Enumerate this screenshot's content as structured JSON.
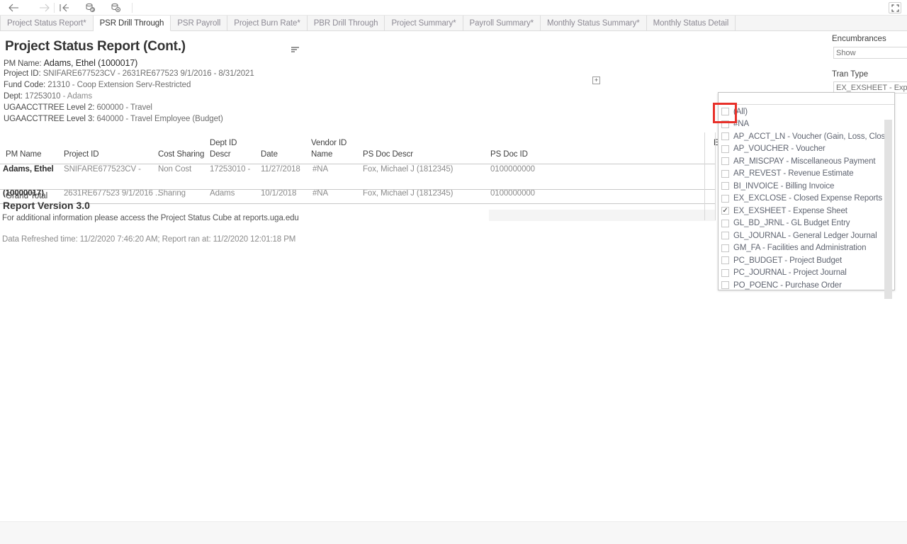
{
  "toolbar": {
    "icons": [
      {
        "name": "back-arrow-icon",
        "glyph": "←"
      },
      {
        "name": "forward-arrow-icon",
        "glyph": "→"
      },
      {
        "name": "revert-all-icon",
        "glyph": "⇤"
      },
      {
        "name": "refresh-data-source-icon",
        "glyph": "refresh"
      },
      {
        "name": "pause-auto-updates-icon",
        "glyph": "pause"
      }
    ],
    "fullscreen_label": "⛶"
  },
  "tabs": [
    {
      "label": "Project Status Report*",
      "active": false
    },
    {
      "label": "PSR Drill Through",
      "active": true
    },
    {
      "label": "PSR Payroll",
      "active": false
    },
    {
      "label": "Project Burn Rate*",
      "active": false
    },
    {
      "label": "PBR Drill Through",
      "active": false
    },
    {
      "label": "Project Summary*",
      "active": false
    },
    {
      "label": "Payroll Summary*",
      "active": false
    },
    {
      "label": "Monthly Status Summary*",
      "active": false
    },
    {
      "label": "Monthly Status Detail",
      "active": false
    }
  ],
  "report": {
    "title": "Project Status Report (Cont.)",
    "meta": {
      "pm_name_label": "PM Name:",
      "pm_name_value": "Adams, Ethel (1000017)",
      "project_id_label": "Project ID:",
      "project_id_value": "SNIFARE677523CV - 2631RE677523 9/1/2016 - 8/31/2021",
      "fund_code_label": "Fund Code:",
      "fund_code_value": "21310 - Coop Extension Serv-Restricted",
      "dept_label": "Dept:",
      "dept_value": "17253010",
      "dept_suffix": " - Adams",
      "level2_label": "UGAACCTTREE Level 2:",
      "level2_value": " 600000 - Travel",
      "level3_label": "UGAACCTTREE Level 3:",
      "level3_value": " 640000 - Travel Employee (Budget)"
    },
    "version": "Report Version 3.0",
    "note": "For additional information please access the Project Status Cube at reports.uga.edu",
    "refresh": "Data Refreshed time: 11/2/2020 7:46:20 AM; Report ran at: 11/2/2020 12:01:18 PM"
  },
  "table": {
    "headers": {
      "pm_name": "PM Name",
      "project_id": "Project ID",
      "cost_sharing": "Cost Sharing",
      "dept_id_descr_l1": "Dept ID",
      "dept_id_descr_l2": "Descr",
      "date": "Date",
      "vendor_id_l1": "Vendor ID",
      "vendor_id_l2": "Name",
      "ps_doc_descr": "PS Doc Descr",
      "ps_doc_id": "PS Doc ID",
      "hidden_col": "E"
    },
    "group_cells": {
      "pm_name_l1": "Adams, Ethel",
      "pm_name_l2": "(10000017)",
      "project_id_l1": "SNIFARE677523CV -",
      "project_id_l2": "2631RE677523 9/1/2016 ..",
      "cost_sharing_l1": "Non Cost",
      "cost_sharing_l2": "Sharing",
      "dept_descr_l1": "17253010 -",
      "dept_descr_l2": "Adams"
    },
    "rows": [
      {
        "date": "11/27/2018",
        "vendor_id_name": "#NA",
        "ps_doc_descr": "Fox, Michael J (1812345)",
        "ps_doc_id": "0100000000"
      },
      {
        "date": "10/1/2018",
        "vendor_id_name": "#NA",
        "ps_doc_descr": "Fox, Michael J (1812345)",
        "ps_doc_id": "0100000000"
      }
    ],
    "grand_total": "Grand Total",
    "expand_glyph": "+"
  },
  "filters": {
    "encumbrances_label": "Encumbrances",
    "encumbrances_value": "Show",
    "tran_type_label": "Tran Type",
    "tran_type_value": "EX_EXSHEET - Exp"
  },
  "dropdown": {
    "search_value": "",
    "items": [
      {
        "label": "(All)",
        "checked": false
      },
      {
        "label": "#NA",
        "checked": false
      },
      {
        "label": "AP_ACCT_LN - Voucher (Gain, Loss, Close)",
        "checked": false
      },
      {
        "label": "AP_VOUCHER - Voucher",
        "checked": false
      },
      {
        "label": "AR_MISCPAY - Miscellaneous Payment",
        "checked": false
      },
      {
        "label": "AR_REVEST - Revenue Estimate",
        "checked": false
      },
      {
        "label": "BI_INVOICE - Billing Invoice",
        "checked": false
      },
      {
        "label": "EX_EXCLOSE - Closed Expense Reports",
        "checked": false
      },
      {
        "label": "EX_EXSHEET - Expense Sheet",
        "checked": true
      },
      {
        "label": "GL_BD_JRNL - GL Budget Entry",
        "checked": false
      },
      {
        "label": "GL_JOURNAL - General Ledger Journal",
        "checked": false
      },
      {
        "label": "GM_FA - Facilities and Administration",
        "checked": false
      },
      {
        "label": "PC_BUDGET - Project Budget",
        "checked": false
      },
      {
        "label": "PC_JOURNAL - Project Journal",
        "checked": false
      },
      {
        "label": "PO_POENC - Purchase Order",
        "checked": false
      }
    ]
  },
  "colors": {
    "highlight": "#e8312a",
    "tab_active_text": "#333333",
    "tab_inactive_text": "#8d8a94"
  }
}
